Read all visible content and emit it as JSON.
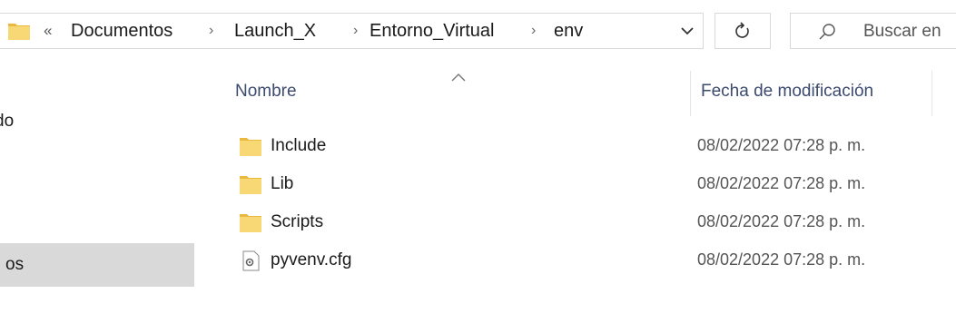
{
  "address_bar": {
    "overflow": "«",
    "crumbs": [
      "Documentos",
      "Launch_X",
      "Entorno_Virtual",
      "env"
    ],
    "separator": "›"
  },
  "search": {
    "placeholder": "Buscar en"
  },
  "navigation": {
    "items": [
      {
        "label": "do"
      },
      {
        "label": "os"
      }
    ]
  },
  "file_list": {
    "columns": {
      "name": "Nombre",
      "date": "Fecha de modificación"
    },
    "rows": [
      {
        "name": "Include",
        "date": "08/02/2022 07:28 p. m.",
        "icon": "folder-icon"
      },
      {
        "name": "Lib",
        "date": "08/02/2022 07:28 p. m.",
        "icon": "folder-icon"
      },
      {
        "name": "Scripts",
        "date": "08/02/2022 07:28 p. m.",
        "icon": "folder-icon"
      },
      {
        "name": "pyvenv.cfg",
        "date": "08/02/2022 07:28 p. m.",
        "icon": "config-file-icon"
      }
    ]
  },
  "colors": {
    "folder": "#f8d775",
    "folder_dark": "#e8b93c",
    "header_text": "#3c4a6e",
    "selected_bg": "#d9d9d9"
  }
}
